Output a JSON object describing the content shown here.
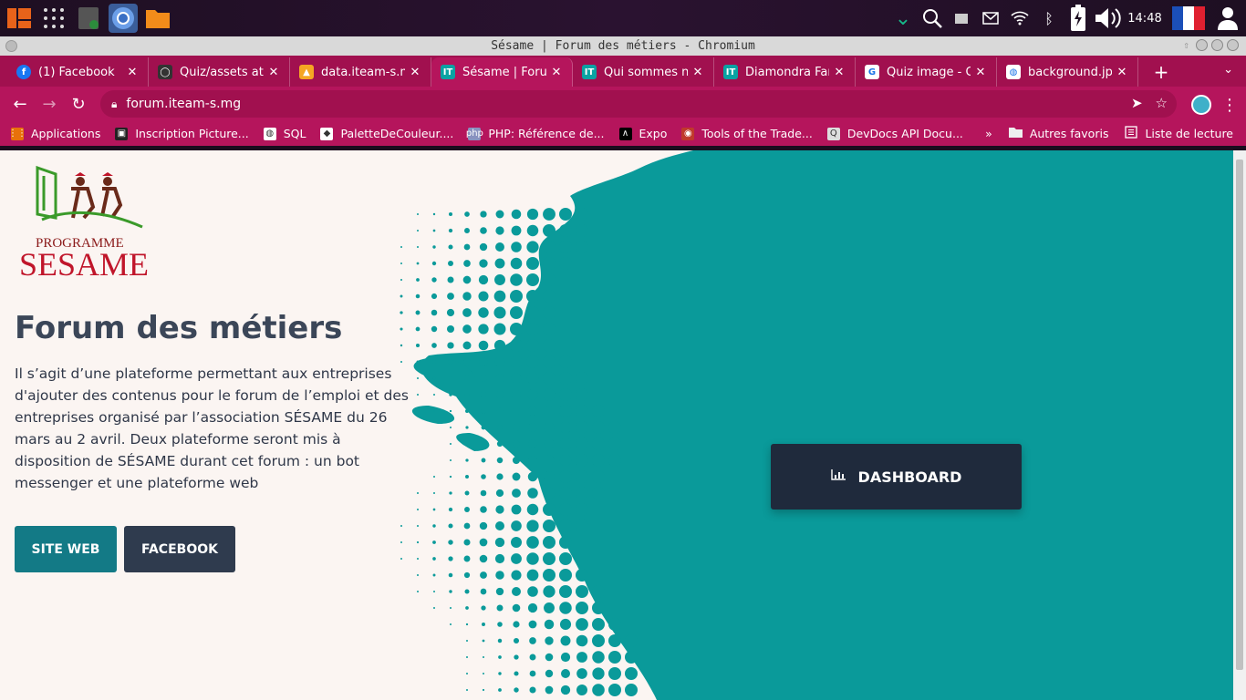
{
  "system": {
    "clock": "14:48"
  },
  "window": {
    "title": "Sésame | Forum des métiers - Chromium"
  },
  "tabs": [
    {
      "label": "(1) Facebook",
      "favicon": "facebook-icon",
      "color": "#1877f2",
      "glyph": "f"
    },
    {
      "label": "Quiz/assets at m",
      "favicon": "github-icon",
      "color": "#333333",
      "glyph": "◯"
    },
    {
      "label": "data.iteam-s.mg",
      "favicon": "xampp-icon",
      "color": "#f5a623",
      "glyph": "▲"
    },
    {
      "label": "Sésame | Forum",
      "favicon": "it-icon",
      "color": "#0aa3a3",
      "glyph": "IT",
      "active": true
    },
    {
      "label": "Qui sommes nou",
      "favicon": "it-icon",
      "color": "#0aa3a3",
      "glyph": "IT"
    },
    {
      "label": "Diamondra Fand",
      "favicon": "it-icon",
      "color": "#0aa3a3",
      "glyph": "IT"
    },
    {
      "label": "Quiz image - Go",
      "favicon": "google-icon",
      "color": "#ffffff",
      "glyph": "G"
    },
    {
      "label": "background.jpg",
      "favicon": "globe-icon",
      "color": "#ffffff",
      "glyph": "◍"
    }
  ],
  "address": {
    "url": "forum.iteam-s.mg"
  },
  "bookmarks": [
    {
      "label": "Applications",
      "icon": "apps-grid-icon",
      "color": "#e8710a",
      "glyph": "⋮⋮"
    },
    {
      "label": "Inscription Picture...",
      "icon": "pictures-icon",
      "color": "#222222",
      "glyph": "▣"
    },
    {
      "label": "SQL",
      "icon": "globe-icon",
      "color": "#ffffff",
      "glyph": "◍"
    },
    {
      "label": "PaletteDeCouleur....",
      "icon": "palette-icon",
      "color": "#ffffff",
      "glyph": "◆"
    },
    {
      "label": "PHP: Référence de...",
      "icon": "php-icon",
      "color": "#8892bf",
      "glyph": "php"
    },
    {
      "label": "Expo",
      "icon": "expo-icon",
      "color": "#000000",
      "glyph": "∧"
    },
    {
      "label": "Tools of the Trade...",
      "icon": "tools-icon",
      "color": "#c0392b",
      "glyph": "◉"
    },
    {
      "label": "DevDocs API Docu...",
      "icon": "devdocs-icon",
      "color": "#dddddd",
      "glyph": "Q"
    }
  ],
  "bookmarks_right": {
    "more": "»",
    "other": "Autres favoris",
    "reading": "Liste de lecture"
  },
  "page": {
    "logo_program": "PROGRAMME",
    "logo_name": "SESAME",
    "headline": "Forum des métiers",
    "description": "Il s’agit d’une plateforme permettant aux entreprises d'ajouter des contenus pour le forum de l’emploi et des entreprises organisé par l’association SÉSAME du 26 mars au 2 avril. Deux plateforme seront mis à disposition de SÉSAME durant cet forum : un bot messenger et une plateforme web",
    "btn_site": "SITE WEB",
    "btn_facebook": "FACEBOOK",
    "btn_dashboard": "DASHBOARD"
  },
  "colors": {
    "browser_accent": "#b5155c",
    "teal": "#0a9a9a",
    "dark_button": "#1f2a3c"
  }
}
